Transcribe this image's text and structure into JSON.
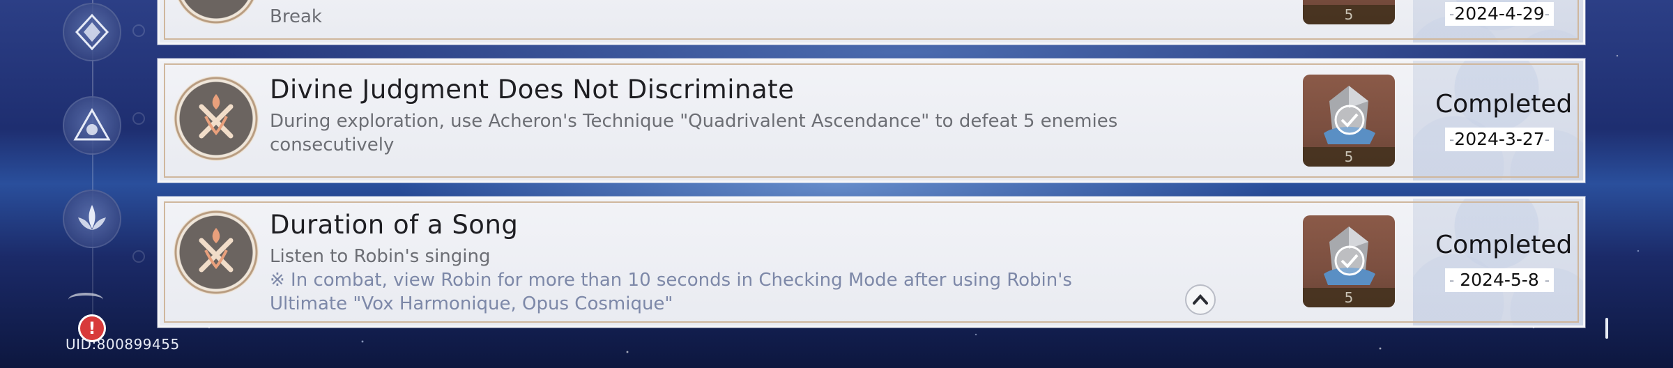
{
  "sidebar": {
    "icons": [
      "emblem-diamond-icon",
      "emblem-triangle-icon",
      "emblem-lotus-icon",
      "emblem-partial-icon"
    ],
    "alert_badge": "!",
    "uid": "UID:800899455"
  },
  "achievements": [
    {
      "title": "",
      "description": "Break",
      "note": "",
      "reward_count": "5",
      "status": "",
      "date": "2024-4-29"
    },
    {
      "title": "Divine Judgment Does Not Discriminate",
      "description": "During exploration, use Acheron's Technique \"Quadrivalent Ascendance\" to defeat 5 enemies consecutively",
      "note": "",
      "reward_count": "5",
      "status": "Completed",
      "date": "2024-3-27"
    },
    {
      "title": "Duration of a Song",
      "description": "Listen to Robin's singing",
      "note": "※ In combat, view Robin for more than 10 seconds in Checking Mode after using Robin's Ultimate \"Vox Harmonique, Opus Cosmique\"",
      "reward_count": "5",
      "status": "Completed",
      "date": "2024-5-8"
    }
  ],
  "colors": {
    "card_border": "#cfb79d",
    "reward_bg": "#7b4f40",
    "note_text": "#7d88a8",
    "alert_red": "#d83a3a"
  }
}
